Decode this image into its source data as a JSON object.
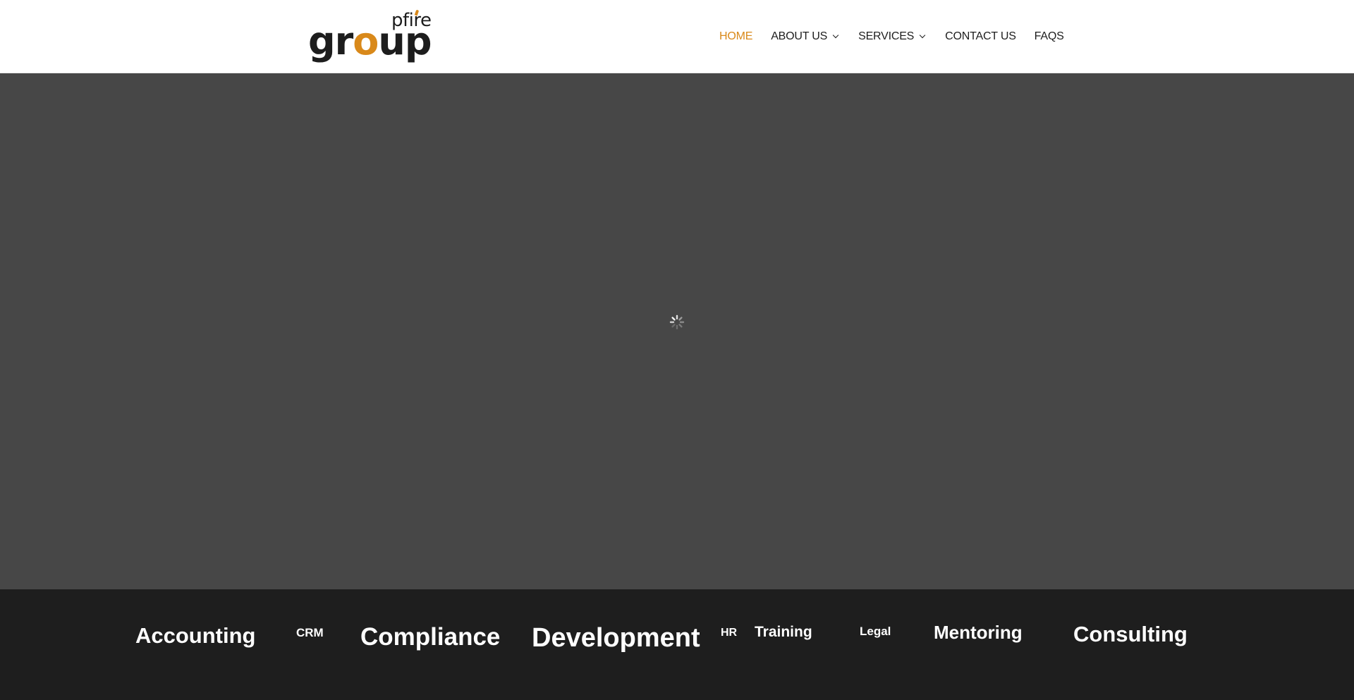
{
  "brand": {
    "wordmark_part1": "gr",
    "wordmark_accent": "o",
    "wordmark_part2": "up",
    "wordmark_sub": "pfire",
    "accent_color": "#d9891a"
  },
  "nav": {
    "items": [
      {
        "label": "HOME",
        "active": true
      },
      {
        "label": "ABOUT US",
        "has_dropdown": true,
        "icon": "chevron-down-icon"
      },
      {
        "label": "SERVICES",
        "has_dropdown": true,
        "icon": "chevron-down-icon"
      },
      {
        "label": "CONTACT US"
      },
      {
        "label": "FAQS"
      }
    ]
  },
  "hero": {
    "background_color": "#474747",
    "state_icon": "loading-spinner-icon"
  },
  "services": {
    "background_color": "#1e1e1e",
    "tags": [
      "Accounting",
      "CRM",
      "Compliance",
      "Development",
      "HR",
      "Training",
      "Legal",
      "Mentoring",
      "Consulting"
    ]
  }
}
